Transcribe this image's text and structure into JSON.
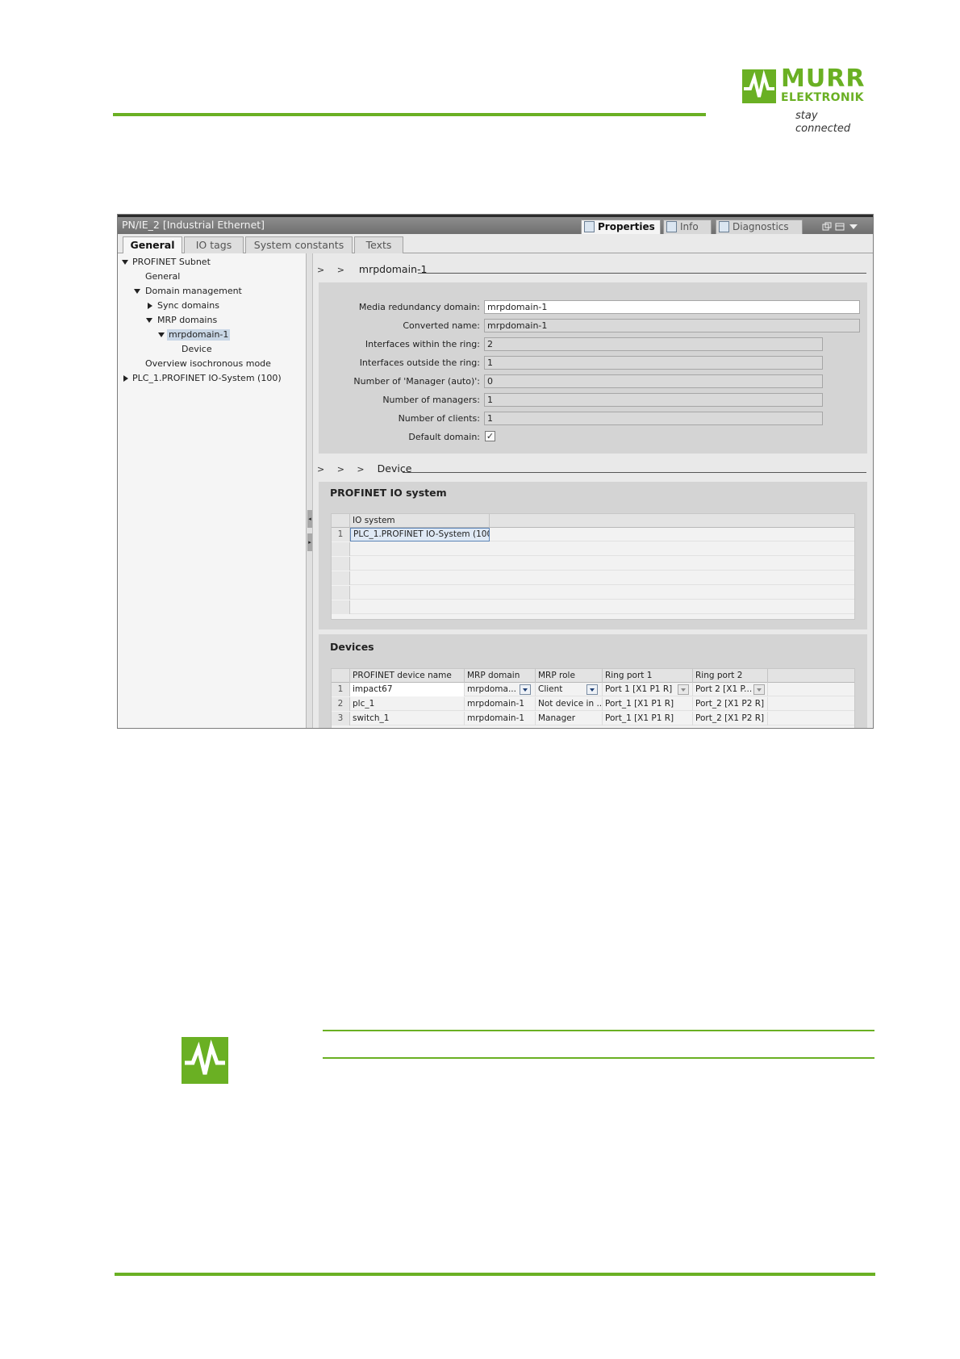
{
  "brand": {
    "line1": "MURR",
    "line2": "ELEKTRONIK",
    "tagline": "stay connected",
    "color": "#6ab023"
  },
  "window": {
    "title": "PN/IE_2 [Industrial Ethernet]",
    "top_tabs": [
      "Properties",
      "Info",
      "Diagnostics"
    ],
    "top_tab_icons": [
      "properties-icon",
      "info-icon",
      "diagnostics-icon"
    ]
  },
  "prop_tabs": [
    "General",
    "IO tags",
    "System constants",
    "Texts"
  ],
  "nav": {
    "items": [
      {
        "label": "PROFINET Subnet"
      },
      {
        "label": "General"
      },
      {
        "label": "Domain management"
      },
      {
        "label": "Sync domains"
      },
      {
        "label": "MRP domains"
      },
      {
        "label": "mrpdomain-1"
      },
      {
        "label": "Device"
      },
      {
        "label": "Overview isochronous mode"
      },
      {
        "label": "PLC_1.PROFINET IO-System (100)"
      }
    ]
  },
  "content": {
    "section1": {
      "chevrons": "> >",
      "title": "mrpdomain-1",
      "fields": [
        {
          "label": "Media redundancy domain:",
          "value": "mrpdomain-1"
        },
        {
          "label": "Converted name:",
          "value": "mrpdomain-1"
        },
        {
          "label": "Interfaces within the ring:",
          "value": "2"
        },
        {
          "label": "Interfaces outside the ring:",
          "value": "1"
        },
        {
          "label": "Number of 'Manager (auto)':",
          "value": "0"
        },
        {
          "label": "Number of managers:",
          "value": "1"
        },
        {
          "label": "Number of clients:",
          "value": "1"
        }
      ],
      "default_domain_label": "Default domain:",
      "default_domain_checked": true,
      "check_glyph": "✓"
    },
    "section2": {
      "chevrons": "> > >",
      "title": "Device"
    },
    "io_system": {
      "title": "PROFINET IO system",
      "column": "IO system",
      "rows": [
        {
          "num": "1",
          "value": "PLC_1.PROFINET IO-System (100)"
        }
      ]
    },
    "devices": {
      "title": "Devices",
      "columns": [
        "PROFINET device name",
        "MRP domain",
        "MRP role",
        "Ring port 1",
        "Ring port 2"
      ],
      "rows": [
        {
          "num": "1",
          "name": "impact67",
          "domain": "mrpdoma...",
          "role": "Client",
          "port1": "Port 1 [X1 P1 R]",
          "port2": "Port 2 [X1 P..."
        },
        {
          "num": "2",
          "name": "plc_1",
          "domain": "mrpdomain-1",
          "role": "Not device in ...",
          "port1": "Port_1 [X1 P1 R]",
          "port2": "Port_2 [X1 P2 R]"
        },
        {
          "num": "3",
          "name": "switch_1",
          "domain": "mrpdomain-1",
          "role": "Manager",
          "port1": "Port_1 [X1 P1 R]",
          "port2": "Port_2 [X1 P2 R]"
        }
      ]
    }
  }
}
